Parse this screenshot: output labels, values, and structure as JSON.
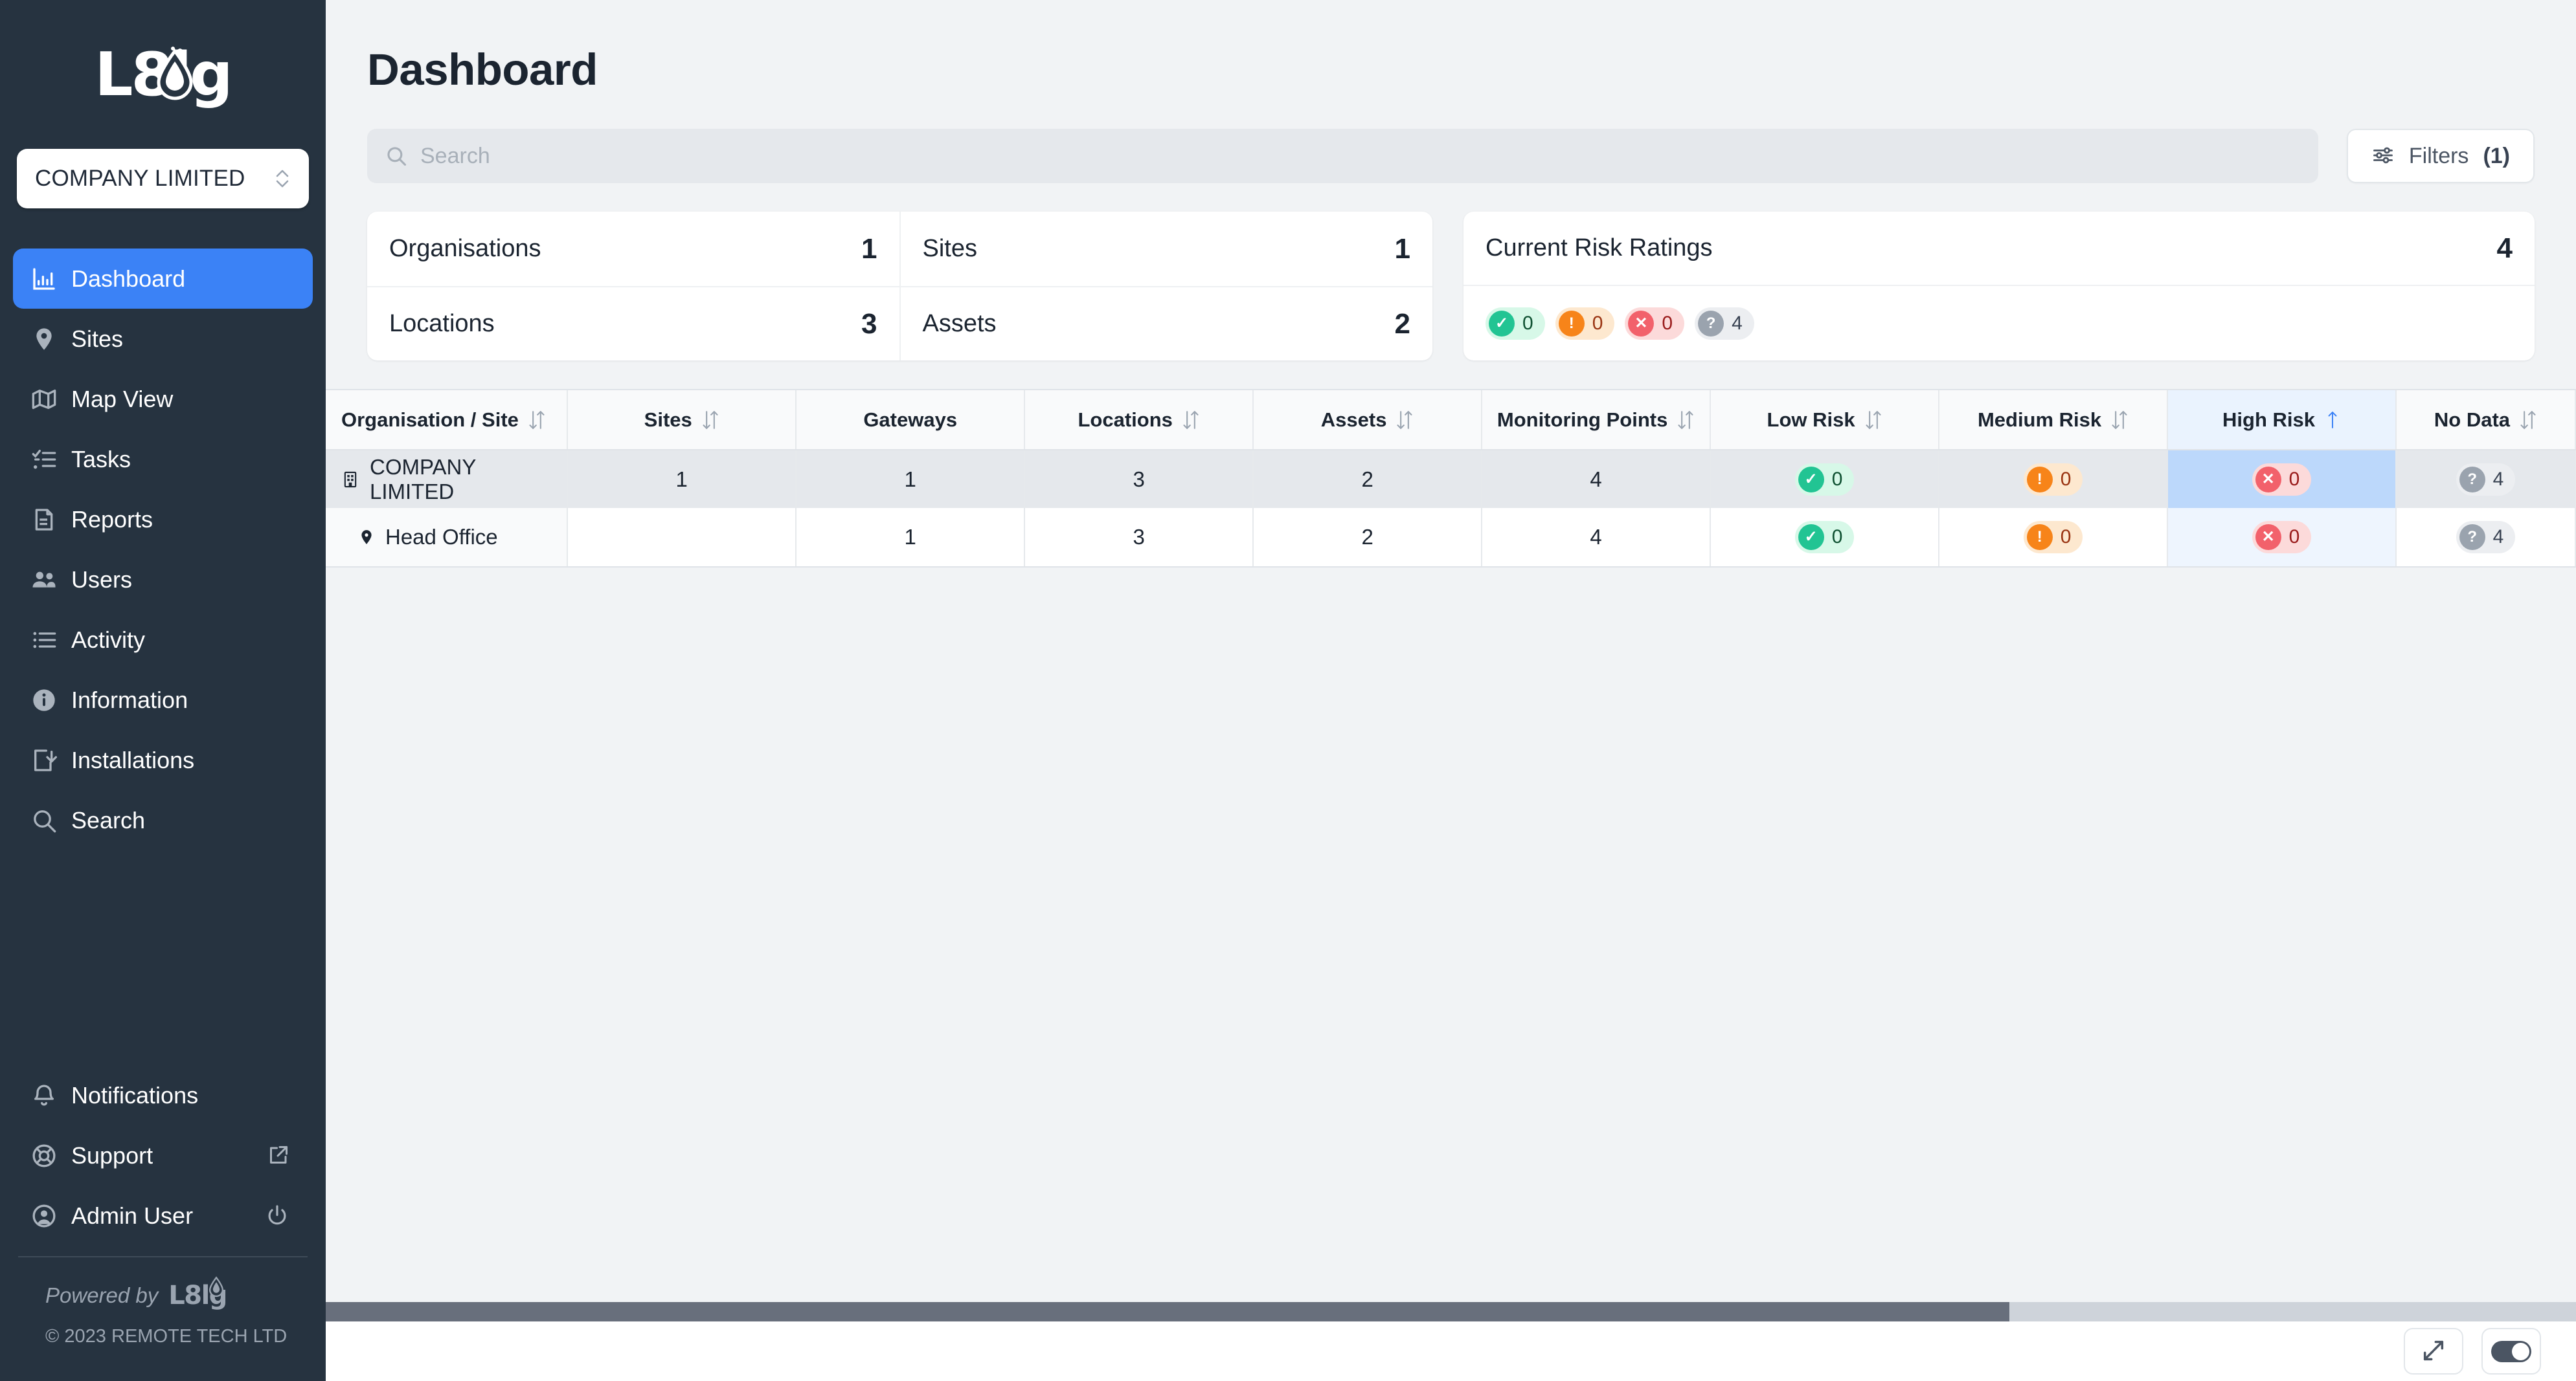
{
  "brand": {
    "logo_text_a": "L8l",
    "logo_text_b": "g",
    "powered_by": "Powered by",
    "powered_logo_a": "L8l",
    "powered_logo_b": "g",
    "copyright": "© 2023 REMOTE TECH LTD"
  },
  "sidebar": {
    "org_selector": {
      "value": "COMPANY LIMITED"
    },
    "items": [
      {
        "label": "Dashboard",
        "icon": "bar-chart-icon",
        "active": true
      },
      {
        "label": "Sites",
        "icon": "map-pin-icon",
        "active": false
      },
      {
        "label": "Map View",
        "icon": "map-icon",
        "active": false
      },
      {
        "label": "Tasks",
        "icon": "task-list-icon",
        "active": false
      },
      {
        "label": "Reports",
        "icon": "document-icon",
        "active": false
      },
      {
        "label": "Users",
        "icon": "users-icon",
        "active": false
      },
      {
        "label": "Activity",
        "icon": "list-icon",
        "active": false
      },
      {
        "label": "Information",
        "icon": "info-icon",
        "active": false
      },
      {
        "label": "Installations",
        "icon": "install-icon",
        "active": false
      },
      {
        "label": "Search",
        "icon": "search-icon",
        "active": false
      }
    ],
    "bottom_items": [
      {
        "label": "Notifications",
        "icon": "bell-icon",
        "trailing_icon": ""
      },
      {
        "label": "Support",
        "icon": "lifebuoy-icon",
        "trailing_icon": "external-link-icon"
      },
      {
        "label": "Admin User",
        "icon": "avatar-icon",
        "trailing_icon": "power-icon"
      }
    ]
  },
  "header": {
    "title": "Dashboard"
  },
  "search": {
    "value": "",
    "placeholder": "Search"
  },
  "filters": {
    "label": "Filters",
    "count": "(1)"
  },
  "stat_cards": [
    {
      "label": "Organisations",
      "value": "1"
    },
    {
      "label": "Locations",
      "value": "3"
    },
    {
      "label": "Sites",
      "value": "1"
    },
    {
      "label": "Assets",
      "value": "2"
    }
  ],
  "risk_card": {
    "title": "Current Risk Ratings",
    "total": "4",
    "chips": [
      {
        "kind": "ok",
        "glyph": "✓",
        "value": "0"
      },
      {
        "kind": "warn",
        "glyph": "!",
        "value": "0"
      },
      {
        "kind": "bad",
        "glyph": "✕",
        "value": "0"
      },
      {
        "kind": "none",
        "glyph": "?",
        "value": "4"
      }
    ]
  },
  "table": {
    "columns": [
      {
        "label": "Organisation / Site",
        "sortable": true,
        "sorted": "none",
        "align": "left",
        "highlight": false
      },
      {
        "label": "Sites",
        "sortable": true,
        "sorted": "none",
        "align": "center",
        "highlight": false
      },
      {
        "label": "Gateways",
        "sortable": false,
        "sorted": "none",
        "align": "center",
        "highlight": false
      },
      {
        "label": "Locations",
        "sortable": true,
        "sorted": "none",
        "align": "center",
        "highlight": false
      },
      {
        "label": "Assets",
        "sortable": true,
        "sorted": "none",
        "align": "center",
        "highlight": false
      },
      {
        "label": "Monitoring Points",
        "sortable": true,
        "sorted": "none",
        "align": "center",
        "highlight": false
      },
      {
        "label": "Low Risk",
        "sortable": true,
        "sorted": "none",
        "align": "center",
        "highlight": false
      },
      {
        "label": "Medium Risk",
        "sortable": true,
        "sorted": "none",
        "align": "center",
        "highlight": false
      },
      {
        "label": "High Risk",
        "sortable": true,
        "sorted": "asc",
        "align": "center",
        "highlight": true
      },
      {
        "label": "No Data",
        "sortable": true,
        "sorted": "none",
        "align": "center",
        "highlight": false
      }
    ],
    "rows": [
      {
        "name": "COMPANY LIMITED",
        "icon": "building-icon",
        "child": false,
        "sites": "1",
        "gateways": "1",
        "locations": "3",
        "assets": "2",
        "monitoring_points": "4",
        "low_risk": "0",
        "medium_risk": "0",
        "high_risk": "0",
        "no_data": "4"
      },
      {
        "name": "Head Office",
        "icon": "map-pin-icon",
        "child": true,
        "sites": "",
        "gateways": "1",
        "locations": "3",
        "assets": "2",
        "monitoring_points": "4",
        "low_risk": "0",
        "medium_risk": "0",
        "high_risk": "0",
        "no_data": "4"
      }
    ]
  },
  "bottom_bar": {
    "expand_button": "expand-icon",
    "toggle_button": "toggle-on-icon"
  },
  "colors": {
    "sidebar_bg": "#263340",
    "accent_blue": "#3b82f6",
    "page_bg": "#f1f3f5",
    "low_risk": "#22c493",
    "medium_risk": "#f78419",
    "high_risk": "#f2616b",
    "no_data": "#9aa3ae",
    "highlight_col": "#eaf3fe"
  }
}
